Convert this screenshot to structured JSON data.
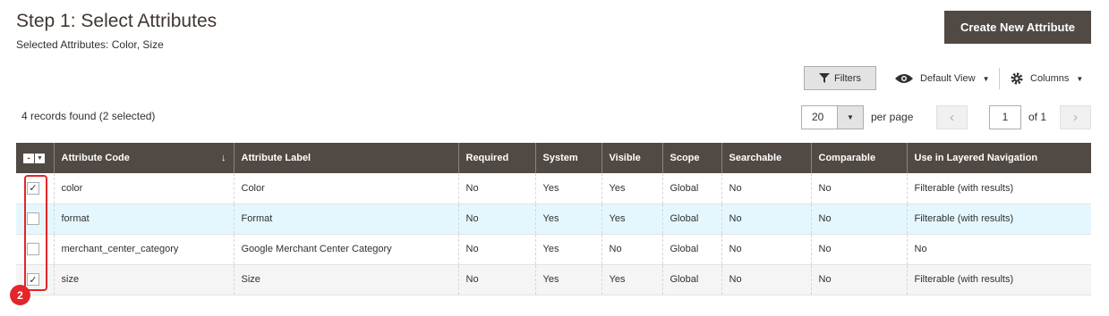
{
  "header": {
    "title": "Step 1: Select Attributes",
    "selected_summary": "Selected Attributes: Color, Size",
    "create_button": "Create New Attribute"
  },
  "toolbar": {
    "filters_label": "Filters",
    "view_label": "Default View",
    "columns_label": "Columns"
  },
  "grid_info": {
    "records": "4 records found (2 selected)",
    "page_size": "20",
    "per_page_label": "per page",
    "current_page": "1",
    "of_label": "of 1"
  },
  "table": {
    "columns": [
      "Attribute Code",
      "Attribute Label",
      "Required",
      "System",
      "Visible",
      "Scope",
      "Searchable",
      "Comparable",
      "Use in Layered Navigation"
    ],
    "rows": [
      {
        "checked": true,
        "cells": [
          "color",
          "Color",
          "No",
          "Yes",
          "Yes",
          "Global",
          "No",
          "No",
          "Filterable (with results)"
        ]
      },
      {
        "checked": false,
        "cells": [
          "format",
          "Format",
          "No",
          "Yes",
          "Yes",
          "Global",
          "No",
          "No",
          "Filterable (with results)"
        ]
      },
      {
        "checked": false,
        "cells": [
          "merchant_center_category",
          "Google Merchant Center Category",
          "No",
          "Yes",
          "No",
          "Global",
          "No",
          "No",
          "No"
        ]
      },
      {
        "checked": true,
        "cells": [
          "size",
          "Size",
          "No",
          "Yes",
          "Yes",
          "Global",
          "No",
          "No",
          "Filterable (with results)"
        ]
      }
    ]
  },
  "annotation": {
    "badge": "2",
    "color": "#e2262a"
  },
  "colors": {
    "header_bg": "#514943",
    "selected_row": "#e5f7fe"
  }
}
